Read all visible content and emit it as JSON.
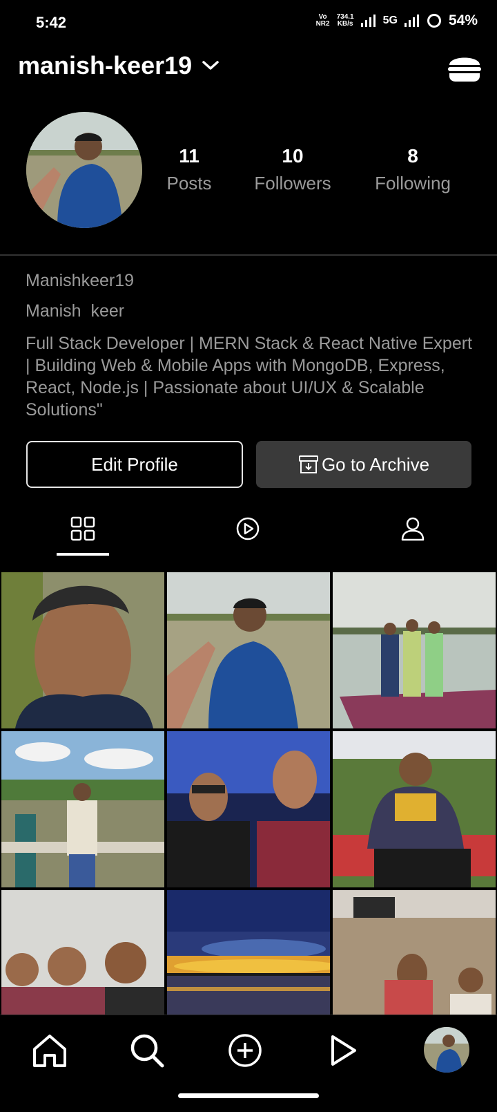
{
  "status_bar": {
    "time": "5:42",
    "vo_top": "Vo",
    "vo_bottom": "NR2",
    "speed_top": "734.1",
    "speed_bottom": "KB/s",
    "network": "5G",
    "battery": "54%"
  },
  "header": {
    "username": "manish-keer19",
    "menu_icon": "hamburger-menu-icon"
  },
  "profile": {
    "stats": [
      {
        "value": "11",
        "label": "Posts"
      },
      {
        "value": "10",
        "label": "Followers"
      },
      {
        "value": "8",
        "label": "Following"
      }
    ],
    "handle": "Manishkeer19",
    "full_name": "Manish  keer",
    "bio": "Full Stack Developer | MERN Stack & React Native Expert | Building Web & Mobile Apps with MongoDB, Express, React, Node.js | Passionate about UI/UX & Scalable Solutions\""
  },
  "actions": {
    "edit_label": "Edit Profile",
    "archive_label": "Go to Archive"
  },
  "tabs": [
    {
      "icon": "grid-icon",
      "active": true
    },
    {
      "icon": "reels-play-icon",
      "active": false
    },
    {
      "icon": "tagged-person-icon",
      "active": false
    }
  ],
  "posts": [
    {
      "subject": "selfie-portrait"
    },
    {
      "subject": "man-on-boat"
    },
    {
      "subject": "three-friends-on-boat"
    },
    {
      "subject": "man-by-fence"
    },
    {
      "subject": "two-friends-night"
    },
    {
      "subject": "man-seated-outdoors"
    },
    {
      "subject": "group-selfie"
    },
    {
      "subject": "sunset-lake"
    },
    {
      "subject": "friends-in-field"
    }
  ],
  "bottom_nav": [
    {
      "icon": "home-icon"
    },
    {
      "icon": "search-icon"
    },
    {
      "icon": "add-post-icon"
    },
    {
      "icon": "reels-icon"
    },
    {
      "icon": "profile-avatar"
    }
  ]
}
